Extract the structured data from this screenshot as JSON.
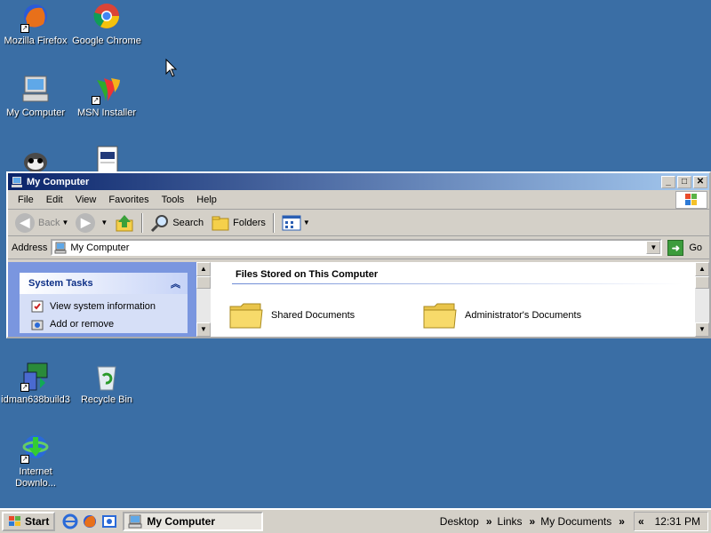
{
  "desktop": {
    "icons": [
      {
        "label": "Mozilla Firefox",
        "icon": "firefox-icon"
      },
      {
        "label": "Google Chrome",
        "icon": "chrome-icon"
      },
      {
        "label": "My Computer",
        "icon": "computer-icon"
      },
      {
        "label": "MSN Installer",
        "icon": "msn-icon"
      },
      {
        "label": "",
        "icon": "raccoon-icon"
      },
      {
        "label": "",
        "icon": "document-icon"
      },
      {
        "label": "idman638build3",
        "icon": "installer-icon"
      },
      {
        "label": "Recycle Bin",
        "icon": "recycle-bin-icon"
      },
      {
        "label": "Internet Downlo...",
        "icon": "idm-icon"
      }
    ]
  },
  "window": {
    "title": "My Computer",
    "menu": [
      "File",
      "Edit",
      "View",
      "Favorites",
      "Tools",
      "Help"
    ],
    "toolbar": {
      "back": "Back",
      "search": "Search",
      "folders": "Folders"
    },
    "address": {
      "label": "Address",
      "value": "My Computer",
      "go": "Go"
    },
    "tasks": {
      "header": "System Tasks",
      "items": [
        "View system information",
        "Add or remove"
      ]
    },
    "section": "Files Stored on This Computer",
    "folders": [
      "Shared Documents",
      "Administrator's Documents"
    ]
  },
  "taskbar": {
    "start": "Start",
    "active_task": "My Computer",
    "toolbars": [
      "Desktop",
      "Links",
      "My Documents"
    ],
    "clock": "12:31 PM"
  },
  "colors": {
    "desktop": "#3a6ea5",
    "titlebar": "#0a246a",
    "taskpane": "#7a96df"
  }
}
